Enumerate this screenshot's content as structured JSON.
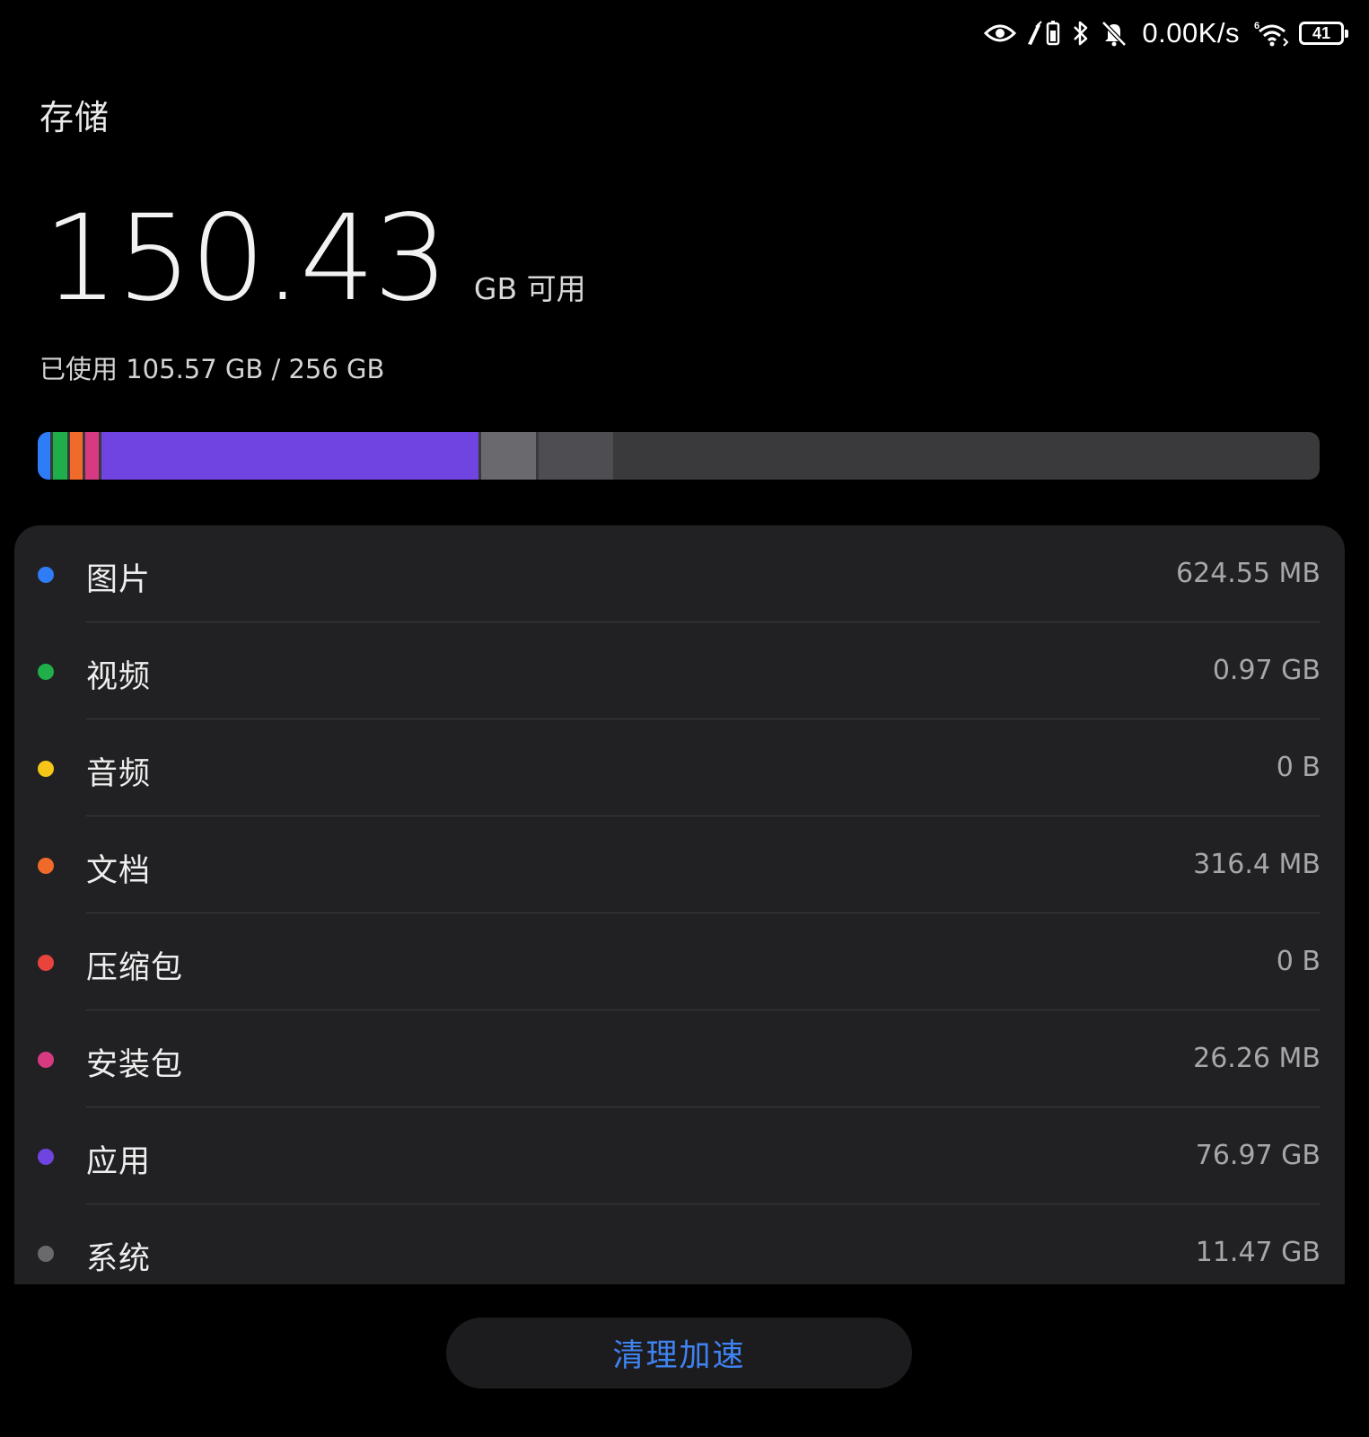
{
  "status_bar": {
    "net_speed": "0.00K/s",
    "battery_level": "41",
    "icons": [
      "eye-icon",
      "phone-charging-icon",
      "bluetooth-icon",
      "bell-muted-icon",
      "wifi-icon",
      "battery-icon"
    ]
  },
  "page": {
    "title": "存储"
  },
  "storage": {
    "free_amount": "150.43",
    "free_unit_label": "GB 可用",
    "used_summary": "已使用 105.57 GB / 256 GB",
    "total_gb": 256
  },
  "colors": {
    "images": "#2e7cf6",
    "videos": "#1fae4a",
    "audio": "#f5c518",
    "documents": "#f06a2a",
    "archives": "#e8433c",
    "packages": "#d83a82",
    "apps": "#6f44e0",
    "system": "#6a6a6e",
    "other": "#4e4e52",
    "free": "#3a3a3c",
    "accent": "#3f83f2",
    "card_background": "#212124"
  },
  "usage_bar": {
    "segments": [
      {
        "name": "images",
        "fraction": 0.012
      },
      {
        "name": "videos",
        "fraction": 0.013
      },
      {
        "name": "documents",
        "fraction": 0.012
      },
      {
        "name": "packages",
        "fraction": 0.013
      },
      {
        "name": "apps",
        "fraction": 0.296
      },
      {
        "name": "system",
        "fraction": 0.045
      },
      {
        "name": "other",
        "fraction": 0.058
      }
    ]
  },
  "categories": [
    {
      "key": "images",
      "label": "图片",
      "size": "624.55 MB"
    },
    {
      "key": "videos",
      "label": "视频",
      "size": "0.97 GB"
    },
    {
      "key": "audio",
      "label": "音频",
      "size": "0 B"
    },
    {
      "key": "documents",
      "label": "文档",
      "size": "316.4 MB"
    },
    {
      "key": "archives",
      "label": "压缩包",
      "size": "0 B"
    },
    {
      "key": "packages",
      "label": "安装包",
      "size": "26.26 MB"
    },
    {
      "key": "apps",
      "label": "应用",
      "size": "76.97 GB"
    },
    {
      "key": "system",
      "label": "系统",
      "size": "11.47 GB"
    }
  ],
  "actions": {
    "clean_label": "清理加速"
  }
}
